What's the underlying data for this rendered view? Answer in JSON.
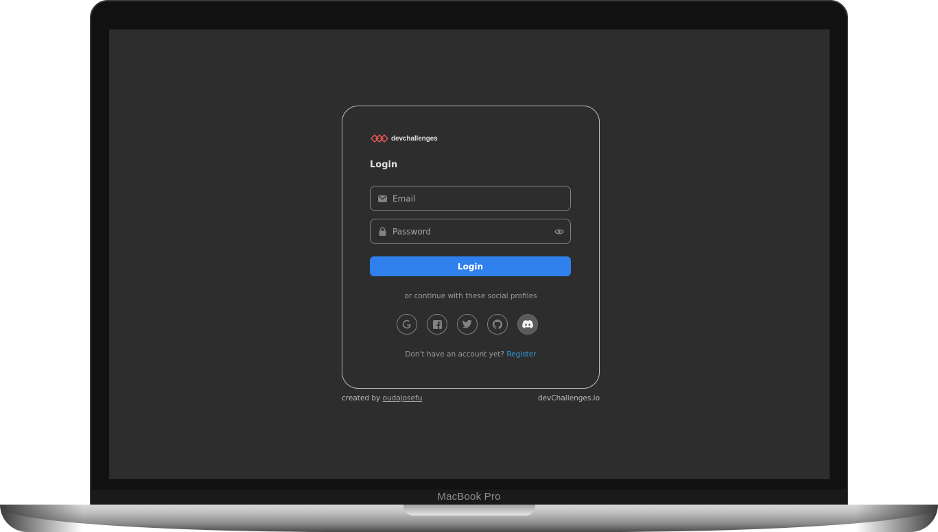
{
  "device": {
    "label": "MacBook Pro"
  },
  "brand": {
    "name": "devchallenges",
    "logo_color": "#eb5757"
  },
  "login": {
    "title": "Login",
    "email_placeholder": "Email",
    "password_placeholder": "Password",
    "email_icon": "envelope-icon",
    "password_icon": "lock-icon",
    "toggle_icon": "eye-icon",
    "submit_label": "Login",
    "accent_color": "#2f80ed"
  },
  "social": {
    "divider_text": "or continue with these social profiles",
    "providers": [
      {
        "name": "google",
        "icon": "google-icon"
      },
      {
        "name": "facebook",
        "icon": "facebook-icon"
      },
      {
        "name": "twitter",
        "icon": "twitter-icon"
      },
      {
        "name": "github",
        "icon": "github-icon"
      },
      {
        "name": "discord",
        "icon": "discord-icon"
      }
    ]
  },
  "register": {
    "prompt": "Don't have an account yet?",
    "link_label": "Register",
    "link_color": "#2d9cdb"
  },
  "footer": {
    "created_by_prefix": "created by",
    "author": "oudajosefu",
    "site": "devChallenges.io"
  }
}
